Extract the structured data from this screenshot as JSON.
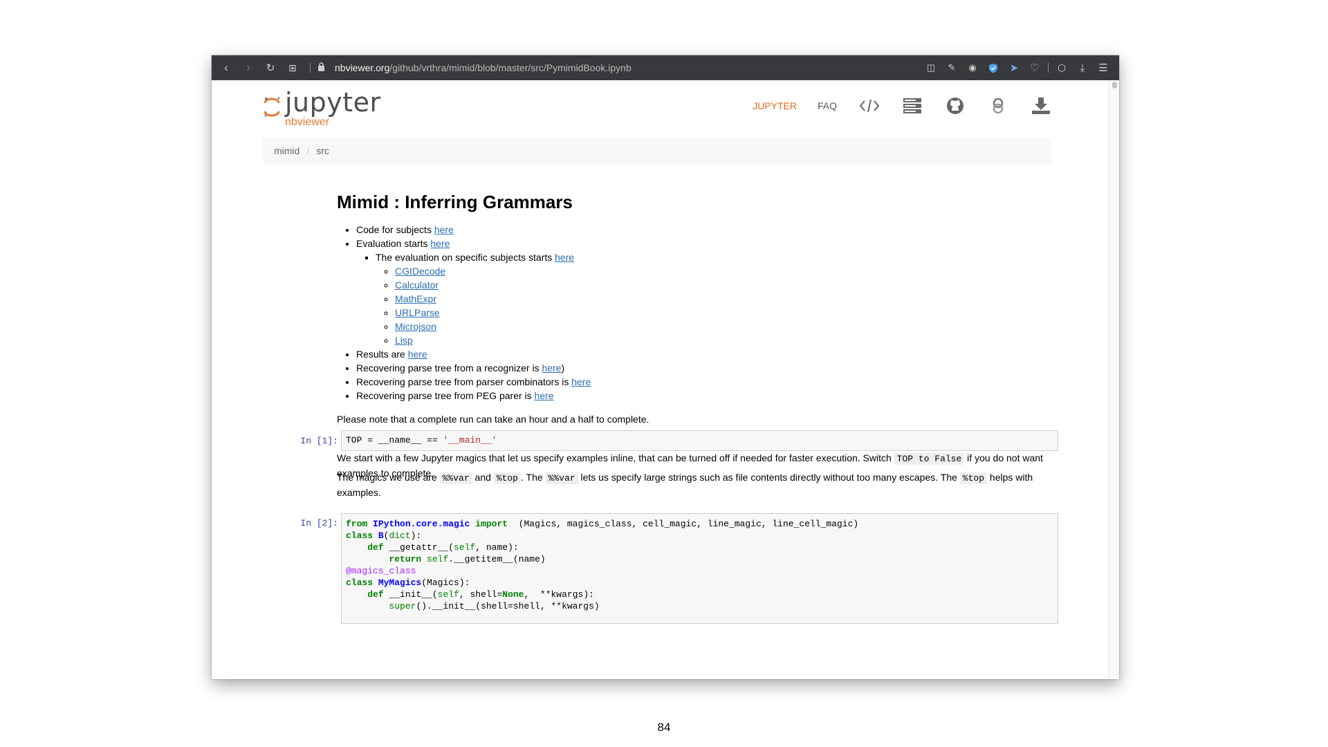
{
  "browser": {
    "url_host": "nbviewer.org",
    "url_path": "/github/vrthra/mimid/blob/master/src/PymimidBook.ipynb",
    "icons": [
      "back-icon",
      "forward-icon",
      "reload-icon",
      "tabs-grid-icon",
      "lock-icon",
      "reader-icon",
      "edit-icon",
      "camera-icon",
      "shield-icon",
      "send-icon",
      "heart-icon",
      "box-icon",
      "download-icon",
      "menu-icon"
    ]
  },
  "header": {
    "logo_title": "jupyter",
    "logo_sub": "nbviewer",
    "nav": {
      "jupyter": "JUPYTER",
      "faq": "FAQ"
    },
    "nav_icons": [
      "code-icon",
      "server-icon",
      "github-icon",
      "binder-icon",
      "download-icon"
    ],
    "accent_color": "#e66a21"
  },
  "breadcrumb": {
    "item1": "mimid",
    "item2": "src"
  },
  "notebook": {
    "title": "Mimid : Inferring Grammars",
    "list": {
      "code_subjects": "Code for subjects ",
      "eval_starts": "Evaluation starts ",
      "eval_specific": "The evaluation on specific subjects starts ",
      "here": "here",
      "subjects": [
        "CGIDecode",
        "Calculator",
        "MathExpr",
        "URLParse",
        "Microjson",
        "Lisp"
      ],
      "results": "Results are ",
      "recover_recognizer": "Recovering parse tree from a recognizer is ",
      "recover_recognizer_end": ")",
      "recover_combinators": "Recovering parse tree from parser combinators is ",
      "recover_peg": "Recovering parse tree from PEG parer is "
    },
    "note": "Please note that a complete run can take an hour and a half to complete.",
    "intro_a": "We start with a few Jupyter magics that let us specify examples inline, that can be turned off if needed for faster execution. Switch ",
    "intro_code": "TOP to False",
    "intro_b": " if you do not want examples to complete.",
    "cell1_prompt": "In [1]:",
    "magics_a": "The magics we use are ",
    "magics_code1": "%%var",
    "magics_b": " and ",
    "magics_code2": "%top",
    "magics_c": ". The ",
    "magics_code3": "%%var",
    "magics_d": " lets us specify large strings such as file contents directly without too many escapes. The ",
    "magics_code4": "%top",
    "magics_e": " helps with examples.",
    "cell2_prompt": "In [2]:"
  },
  "page_number": "84"
}
